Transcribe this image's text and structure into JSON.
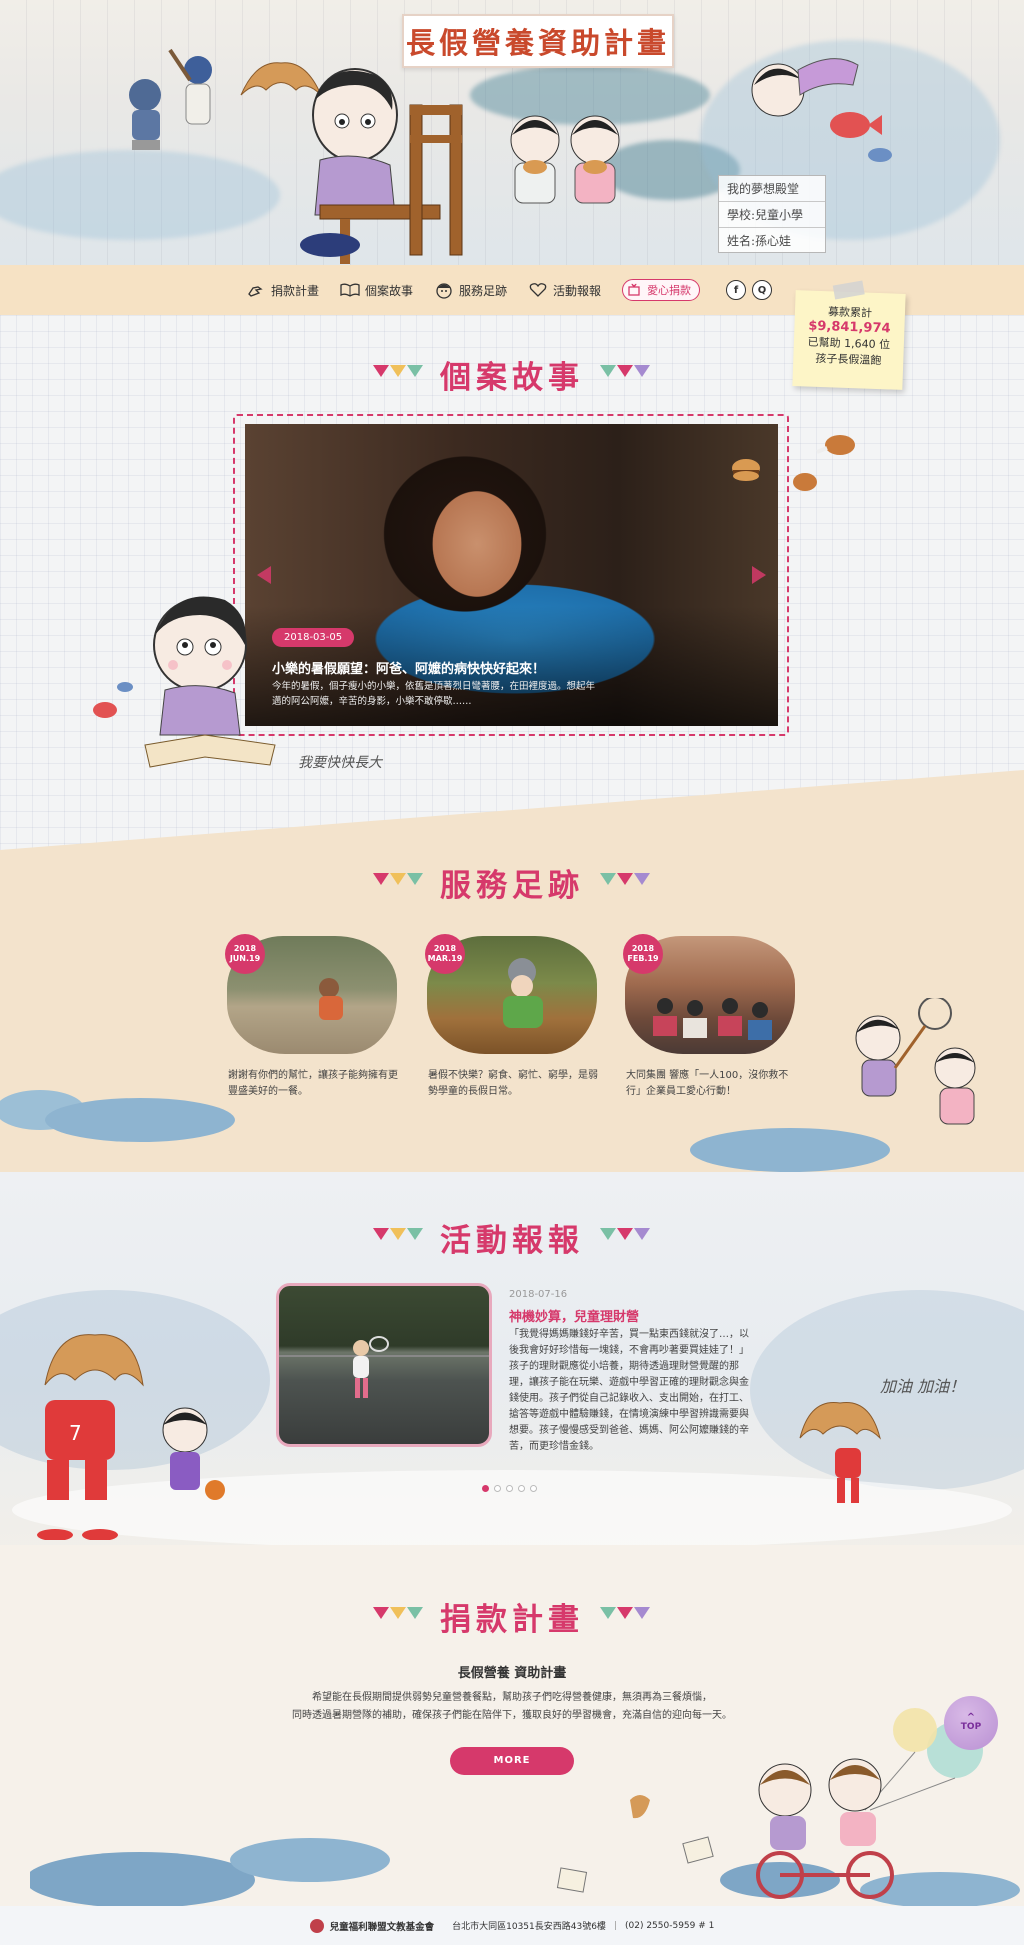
{
  "hero": {
    "title": "長假營養資助計畫",
    "note_lines": [
      "我的夢想殿堂",
      "學校:兒童小學",
      "姓名:孫心娃"
    ]
  },
  "nav": {
    "items": [
      {
        "label": "捐款計畫",
        "icon": "hand-icon"
      },
      {
        "label": "個案故事",
        "icon": "book-icon"
      },
      {
        "label": "服務足跡",
        "icon": "face-icon"
      },
      {
        "label": "活動報報",
        "icon": "heart-icon"
      }
    ],
    "donate_label": "愛心捐款",
    "social": [
      "f",
      "Q"
    ]
  },
  "counter": {
    "line1": "募款累計",
    "amount": "$9,841,974",
    "line3": "已幫助 1,640 位",
    "line4": "孩子長假溫飽"
  },
  "story": {
    "title": "個案故事",
    "date": "2018-03-05",
    "headline": "小樂的暑假願望：阿爸、阿嬤的病快快好起來！",
    "text": "今年的暑假，個子瘦小的小樂，依舊是頂著烈日彎著腰，在田裡度過。想起年邁的阿公阿嬤，辛苦的身影，小樂不敢停歇……",
    "caption": "我要快快長大"
  },
  "service": {
    "title": "服務足跡",
    "cards": [
      {
        "year": "2018",
        "date": "JUN.19",
        "text": "謝謝有你們的幫忙，讓孩子能夠擁有更豐盛美好的一餐。"
      },
      {
        "year": "2018",
        "date": "MAR.19",
        "text": "暑假不快樂？窮食、窮忙、窮學，是弱勢學童的長假日常。"
      },
      {
        "year": "2018",
        "date": "FEB.19",
        "text": "大同集團 響應「一人100，沒你救不行」企業員工愛心行動！"
      }
    ]
  },
  "news": {
    "title": "活動報報",
    "date": "2018-07-16",
    "headline": "神機妙算，兒童理財營",
    "body": "「我覺得媽媽賺錢好辛苦，買一點東西錢就沒了…，以後我會好好珍惜每一塊錢，不會再吵著要買娃娃了！」孩子的理財觀應從小培養，期待透過理財營覺醒的那理，讓孩子能在玩樂、遊戲中學習正確的理財觀念與金錢使用。孩子們從自己記錄收入、支出開始，在打工、搶答等遊戲中體驗賺錢，在情境演練中學習辨識需要與想要。孩子慢慢感受到爸爸、媽媽、阿公阿嬤賺錢的辛苦，而更珍惜金錢。",
    "cheer": "加油 加油！",
    "dots": 5,
    "active_dot": 0
  },
  "donation": {
    "title": "捐款計畫",
    "subtitle": "長假營養 資助計畫",
    "line1": "希望能在長假期間提供弱勢兒童營養餐點，幫助孩子們吃得營養健康，無須再為三餐煩惱，",
    "line2": "同時透過暑期營隊的補助，確保孩子們能在陪伴下，獲取良好的學習機會，充滿自信的迎向每一天。",
    "more_label": "MORE",
    "top_label": "TOP"
  },
  "footer": {
    "org": "兒童福利聯盟文教基金會",
    "address": "台北市大同區10351長安西路43號6樓",
    "phone": "(02) 2550-5959 # 1"
  },
  "colors": {
    "accent": "#d6396b",
    "nav_bg": "#f6e2c4",
    "beige": "#f3e3cc",
    "note_yellow": "#fdf5c7"
  }
}
